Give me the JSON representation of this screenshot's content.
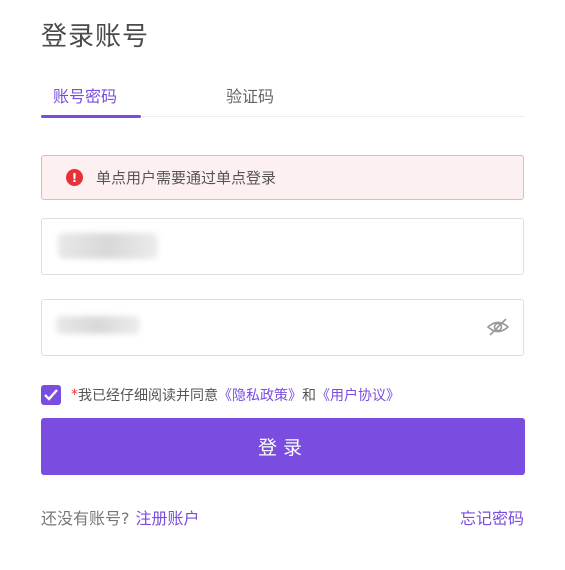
{
  "page": {
    "title": "登录账号"
  },
  "tabs": [
    {
      "label": "账号密码",
      "active": true
    },
    {
      "label": "验证码",
      "active": false
    }
  ],
  "alert": {
    "icon": "error-icon",
    "text": "单点用户需要通过单点登录"
  },
  "form": {
    "username": {
      "value": "",
      "redacted": true
    },
    "password": {
      "value": "",
      "redacted": true,
      "toggle_icon": "eye-hidden-icon"
    }
  },
  "agreement": {
    "checked": true,
    "required_mark": "*",
    "prefix": "我已经仔细阅读并同意",
    "privacy_link": "《隐私政策》",
    "conjunction": "和",
    "terms_link": "《用户协议》"
  },
  "login_button": {
    "label": "登录"
  },
  "footer": {
    "no_account_text": "还没有账号?",
    "register_link": "注册账户",
    "forgot_link": "忘记密码"
  },
  "colors": {
    "accent": "#7a4ce0",
    "error": "#e5323b",
    "alert_bg": "#fdf0f0"
  }
}
